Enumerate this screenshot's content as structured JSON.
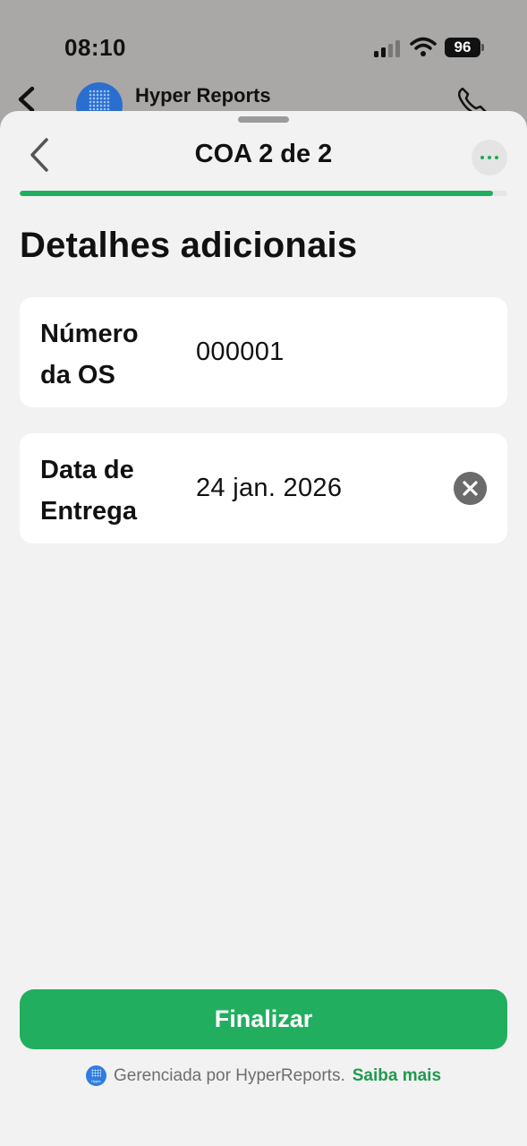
{
  "status_bar": {
    "time": "08:10",
    "battery": "96"
  },
  "chat_header": {
    "name": "Hyper Reports"
  },
  "sheet": {
    "title": "COA 2 de 2",
    "progress": 0.97,
    "section_title": "Detalhes adicionais",
    "fields": [
      {
        "label": "Número da OS",
        "value": "000001"
      },
      {
        "label": "Data de Entrega",
        "value": "24 jan. 2026"
      }
    ],
    "primary_button": "Finalizar",
    "footer": {
      "logo_text": "Hyper",
      "text": "Gerenciada por HyperReports.",
      "link": "Saiba mais"
    }
  },
  "colors": {
    "accent": "#22ae5f",
    "link": "#1f9a4f",
    "sheet_bg": "#f2f2f2",
    "overlay_bg": "#a9a8a6"
  }
}
